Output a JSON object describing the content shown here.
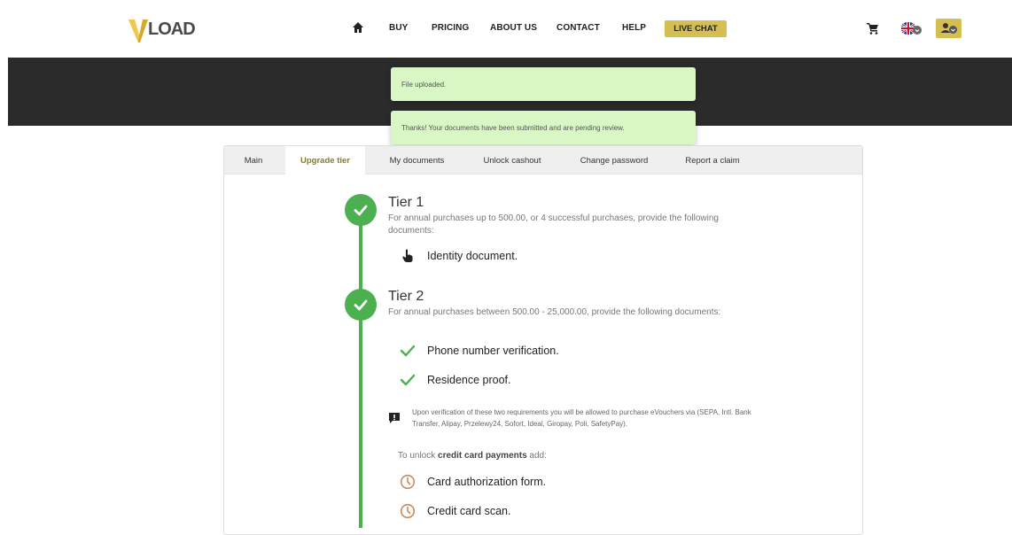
{
  "header": {
    "logo_text": "VLOAD",
    "nav": [
      {
        "label": "BUY"
      },
      {
        "label": "PRICING"
      },
      {
        "label": "ABOUT US"
      },
      {
        "label": "CONTACT"
      },
      {
        "label": "HELP"
      }
    ],
    "live_chat": "LIVE CHAT"
  },
  "toasts": [
    {
      "message": "File uploaded."
    },
    {
      "message": "Thanks! Your documents have been submitted and are pending review."
    }
  ],
  "tabs": [
    {
      "label": "Main",
      "active": false
    },
    {
      "label": "Upgrade tier",
      "active": true
    },
    {
      "label": "My documents",
      "active": false
    },
    {
      "label": "Unlock cashout",
      "active": false
    },
    {
      "label": "Change password",
      "active": false
    },
    {
      "label": "Report a claim",
      "active": false
    }
  ],
  "tiers": [
    {
      "title": "Tier 1",
      "description": "For annual purchases up to 500.00, or 4 successful purchases, provide the following documents:",
      "requirements": [
        {
          "label": "Identity document.",
          "icon": "hand-pointer-icon"
        }
      ]
    },
    {
      "title": "Tier 2",
      "description": "For annual purchases between 500.00 - 25,000.00, provide the following documents:",
      "requirements": [
        {
          "label": "Phone number verification.",
          "icon": "check-icon"
        },
        {
          "label": "Residence proof.",
          "icon": "check-icon"
        }
      ],
      "notice": "Upon verification of these two requirements you will be allowed to purchase eVouchers via (SEPA, Intl. Bank Transfer, Alipay, Przelewy24, Sofort, Ideal, Giropay, Poli, SafetyPay).",
      "unlock_prefix": "To unlock",
      "unlock_bold": "credit card payments",
      "unlock_suffix": "add:",
      "extra_requirements": [
        {
          "label": "Card authorization form.",
          "icon": "clock-icon"
        },
        {
          "label": "Credit card scan.",
          "icon": "clock-icon"
        }
      ]
    }
  ],
  "colors": {
    "accent_gold": "#d6bf52",
    "success_green": "#4caf50",
    "toast_bg": "#d8f7c4",
    "pending_orange": "#c98a5a"
  }
}
